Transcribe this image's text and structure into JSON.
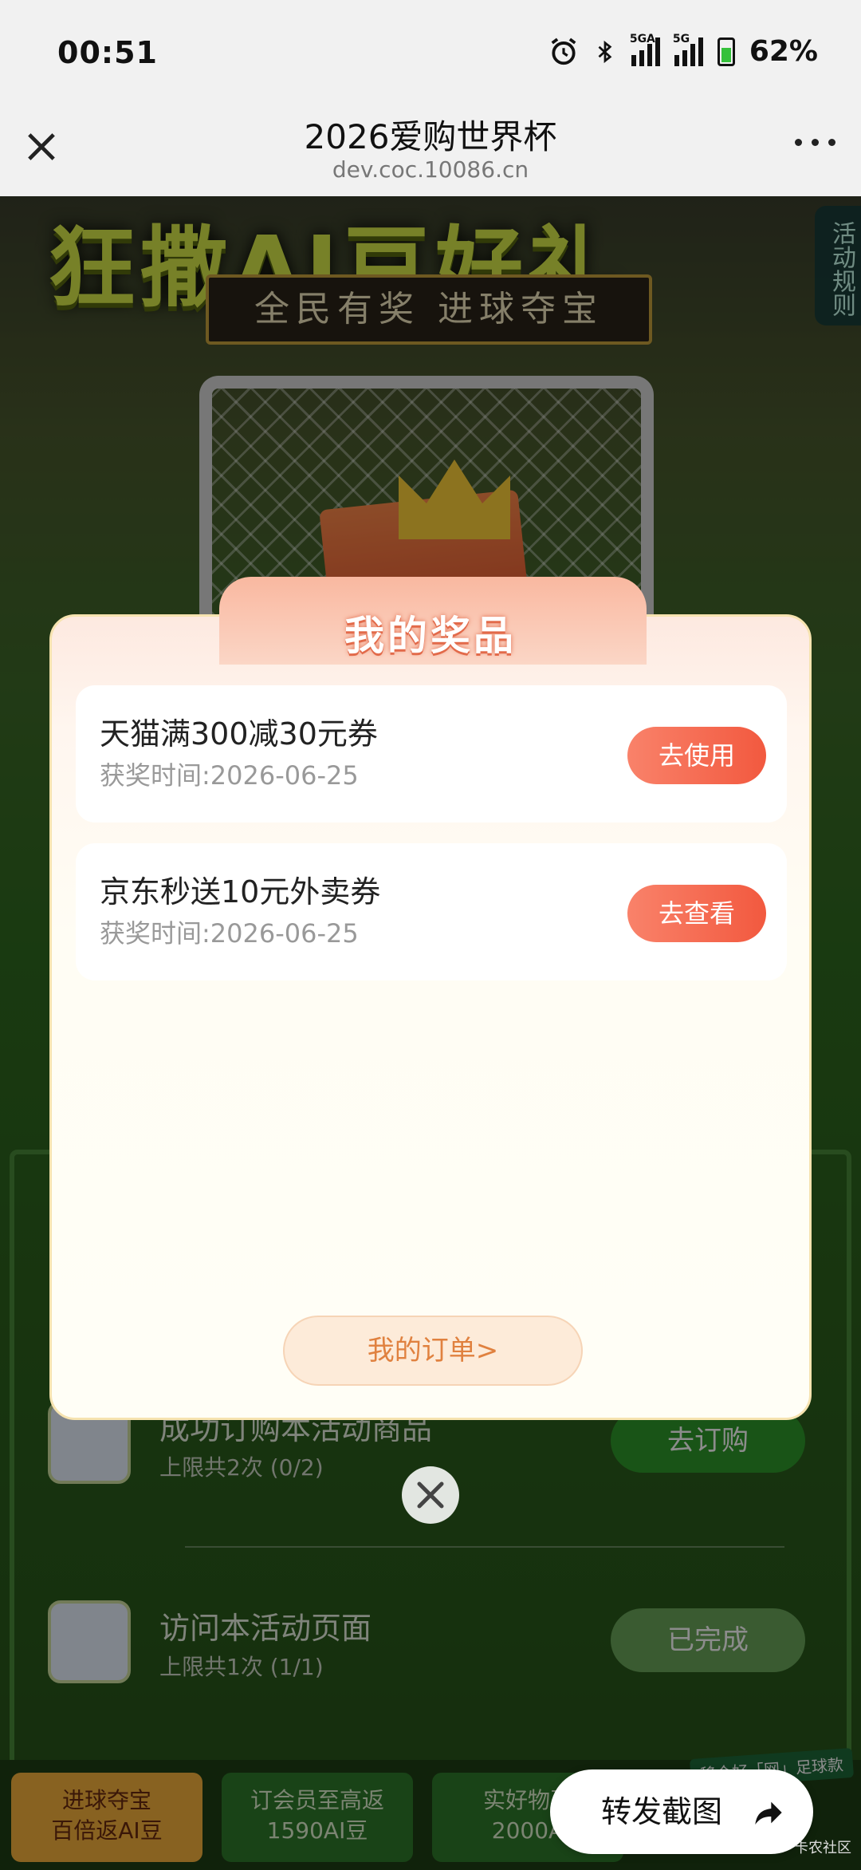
{
  "status_bar": {
    "time": "00:51",
    "net1": "5GA",
    "net2": "5G",
    "battery": "62%"
  },
  "nav": {
    "title": "2026爱购世界杯",
    "url": "dev.coc.10086.cn"
  },
  "banner": {
    "title": "狂撒AI豆好礼",
    "subtitle": "全民有奖 进球夺宝",
    "rules": "活动规则"
  },
  "tasks": [
    {
      "name": "成功订购本活动商品",
      "limit": "上限共2次 (0/2)",
      "button": "去订购"
    },
    {
      "name": "访问本活动页面",
      "limit": "上限共1次 (1/1)",
      "button": "已完成"
    }
  ],
  "bottom_tabs": [
    {
      "line1": "进球夺宝",
      "line2": "百倍返AI豆"
    },
    {
      "line1": "订会员至高返",
      "line2": "1590AI豆"
    },
    {
      "line1": "实好物至",
      "line2": "2000A"
    }
  ],
  "badge": "移个好「网」足球款",
  "modal": {
    "title": "我的奖品",
    "prizes": [
      {
        "name": "天猫满300减30元券",
        "time": "获奖时间:2026-06-25",
        "button": "去使用"
      },
      {
        "name": "京东秒送10元外卖券",
        "time": "获奖时间:2026-06-25",
        "button": "去查看"
      }
    ],
    "orders_button": "我的订单>"
  },
  "share": {
    "label": "转发截图"
  },
  "watermark": "卡农社区",
  "colors": {
    "accent": "#f2593f",
    "orders_text": "#e0813f",
    "task_green": "#2f9a2a"
  }
}
